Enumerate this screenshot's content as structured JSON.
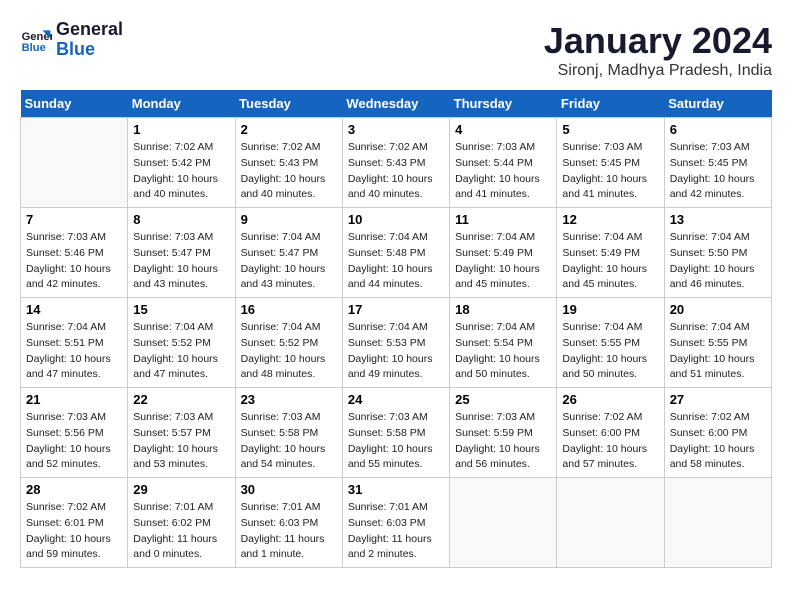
{
  "logo": {
    "line1": "General",
    "line2": "Blue"
  },
  "title": "January 2024",
  "subtitle": "Sironj, Madhya Pradesh, India",
  "headers": [
    "Sunday",
    "Monday",
    "Tuesday",
    "Wednesday",
    "Thursday",
    "Friday",
    "Saturday"
  ],
  "weeks": [
    [
      {
        "day": "",
        "empty": true
      },
      {
        "day": "1",
        "sunrise": "7:02 AM",
        "sunset": "5:42 PM",
        "daylight": "10 hours and 40 minutes."
      },
      {
        "day": "2",
        "sunrise": "7:02 AM",
        "sunset": "5:43 PM",
        "daylight": "10 hours and 40 minutes."
      },
      {
        "day": "3",
        "sunrise": "7:02 AM",
        "sunset": "5:43 PM",
        "daylight": "10 hours and 40 minutes."
      },
      {
        "day": "4",
        "sunrise": "7:03 AM",
        "sunset": "5:44 PM",
        "daylight": "10 hours and 41 minutes."
      },
      {
        "day": "5",
        "sunrise": "7:03 AM",
        "sunset": "5:45 PM",
        "daylight": "10 hours and 41 minutes."
      },
      {
        "day": "6",
        "sunrise": "7:03 AM",
        "sunset": "5:45 PM",
        "daylight": "10 hours and 42 minutes."
      }
    ],
    [
      {
        "day": "7",
        "sunrise": "7:03 AM",
        "sunset": "5:46 PM",
        "daylight": "10 hours and 42 minutes."
      },
      {
        "day": "8",
        "sunrise": "7:03 AM",
        "sunset": "5:47 PM",
        "daylight": "10 hours and 43 minutes."
      },
      {
        "day": "9",
        "sunrise": "7:04 AM",
        "sunset": "5:47 PM",
        "daylight": "10 hours and 43 minutes."
      },
      {
        "day": "10",
        "sunrise": "7:04 AM",
        "sunset": "5:48 PM",
        "daylight": "10 hours and 44 minutes."
      },
      {
        "day": "11",
        "sunrise": "7:04 AM",
        "sunset": "5:49 PM",
        "daylight": "10 hours and 45 minutes."
      },
      {
        "day": "12",
        "sunrise": "7:04 AM",
        "sunset": "5:49 PM",
        "daylight": "10 hours and 45 minutes."
      },
      {
        "day": "13",
        "sunrise": "7:04 AM",
        "sunset": "5:50 PM",
        "daylight": "10 hours and 46 minutes."
      }
    ],
    [
      {
        "day": "14",
        "sunrise": "7:04 AM",
        "sunset": "5:51 PM",
        "daylight": "10 hours and 47 minutes."
      },
      {
        "day": "15",
        "sunrise": "7:04 AM",
        "sunset": "5:52 PM",
        "daylight": "10 hours and 47 minutes."
      },
      {
        "day": "16",
        "sunrise": "7:04 AM",
        "sunset": "5:52 PM",
        "daylight": "10 hours and 48 minutes."
      },
      {
        "day": "17",
        "sunrise": "7:04 AM",
        "sunset": "5:53 PM",
        "daylight": "10 hours and 49 minutes."
      },
      {
        "day": "18",
        "sunrise": "7:04 AM",
        "sunset": "5:54 PM",
        "daylight": "10 hours and 50 minutes."
      },
      {
        "day": "19",
        "sunrise": "7:04 AM",
        "sunset": "5:55 PM",
        "daylight": "10 hours and 50 minutes."
      },
      {
        "day": "20",
        "sunrise": "7:04 AM",
        "sunset": "5:55 PM",
        "daylight": "10 hours and 51 minutes."
      }
    ],
    [
      {
        "day": "21",
        "sunrise": "7:03 AM",
        "sunset": "5:56 PM",
        "daylight": "10 hours and 52 minutes."
      },
      {
        "day": "22",
        "sunrise": "7:03 AM",
        "sunset": "5:57 PM",
        "daylight": "10 hours and 53 minutes."
      },
      {
        "day": "23",
        "sunrise": "7:03 AM",
        "sunset": "5:58 PM",
        "daylight": "10 hours and 54 minutes."
      },
      {
        "day": "24",
        "sunrise": "7:03 AM",
        "sunset": "5:58 PM",
        "daylight": "10 hours and 55 minutes."
      },
      {
        "day": "25",
        "sunrise": "7:03 AM",
        "sunset": "5:59 PM",
        "daylight": "10 hours and 56 minutes."
      },
      {
        "day": "26",
        "sunrise": "7:02 AM",
        "sunset": "6:00 PM",
        "daylight": "10 hours and 57 minutes."
      },
      {
        "day": "27",
        "sunrise": "7:02 AM",
        "sunset": "6:00 PM",
        "daylight": "10 hours and 58 minutes."
      }
    ],
    [
      {
        "day": "28",
        "sunrise": "7:02 AM",
        "sunset": "6:01 PM",
        "daylight": "10 hours and 59 minutes."
      },
      {
        "day": "29",
        "sunrise": "7:01 AM",
        "sunset": "6:02 PM",
        "daylight": "11 hours and 0 minutes."
      },
      {
        "day": "30",
        "sunrise": "7:01 AM",
        "sunset": "6:03 PM",
        "daylight": "11 hours and 1 minute."
      },
      {
        "day": "31",
        "sunrise": "7:01 AM",
        "sunset": "6:03 PM",
        "daylight": "11 hours and 2 minutes."
      },
      {
        "day": "",
        "empty": true
      },
      {
        "day": "",
        "empty": true
      },
      {
        "day": "",
        "empty": true
      }
    ]
  ]
}
